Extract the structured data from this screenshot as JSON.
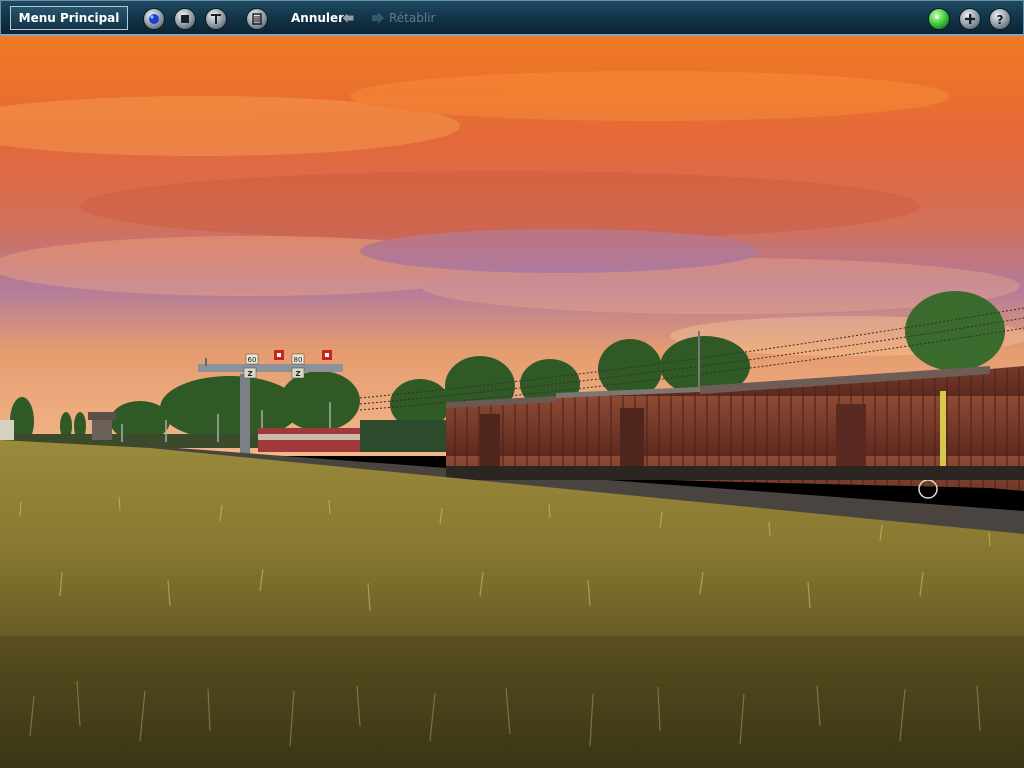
{
  "toolbar": {
    "menu_label": "Menu Principal",
    "undo_label": "Annuler",
    "redo_label": "Rétablir",
    "left_icons": [
      "blue-orb-icon",
      "stop-icon",
      "tools-icon",
      "trash-icon"
    ],
    "right_icons": [
      "green-light-icon",
      "plus-icon",
      "help-icon"
    ]
  },
  "signal": {
    "speed_left": "60",
    "speed_right": "80",
    "letter": "Z"
  },
  "colors": {
    "toolbar": "#123246",
    "sky_top": "#f07a22",
    "sky_purple": "#a77fa8",
    "wagon": "#7a3a2a",
    "field": "#b39a43"
  }
}
